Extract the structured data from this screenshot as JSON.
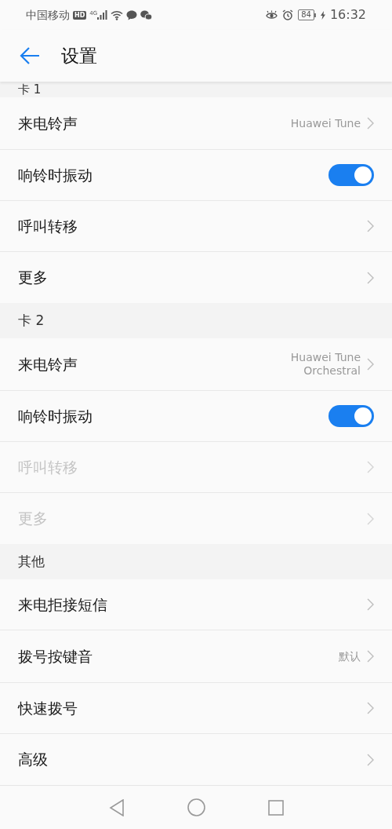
{
  "status_bar": {
    "carrier": "中国移动",
    "hd_badge": "HD",
    "network": "4G",
    "battery": "84",
    "time": "16:32"
  },
  "app_bar": {
    "title": "设置"
  },
  "sections": [
    {
      "header": "卡 1",
      "items": [
        {
          "kind": "link",
          "label": "来电铃声",
          "value": "Huawei Tune",
          "disabled": false
        },
        {
          "kind": "switch",
          "label": "响铃时振动",
          "on": true,
          "disabled": false
        },
        {
          "kind": "link",
          "label": "呼叫转移",
          "disabled": false
        },
        {
          "kind": "link",
          "label": "更多",
          "disabled": false
        }
      ]
    },
    {
      "header": "卡 2",
      "items": [
        {
          "kind": "link",
          "label": "来电铃声",
          "value": "Huawei Tune Orchestral",
          "disabled": false
        },
        {
          "kind": "switch",
          "label": "响铃时振动",
          "on": true,
          "disabled": false
        },
        {
          "kind": "link",
          "label": "呼叫转移",
          "disabled": true
        },
        {
          "kind": "link",
          "label": "更多",
          "disabled": true
        }
      ]
    },
    {
      "header": "其他",
      "items": [
        {
          "kind": "link",
          "label": "来电拒接短信",
          "disabled": false
        },
        {
          "kind": "link",
          "label": "拨号按键音",
          "value": "默认",
          "disabled": false
        },
        {
          "kind": "link",
          "label": "快速拨号",
          "disabled": false
        },
        {
          "kind": "link",
          "label": "高级",
          "disabled": false
        }
      ]
    }
  ]
}
